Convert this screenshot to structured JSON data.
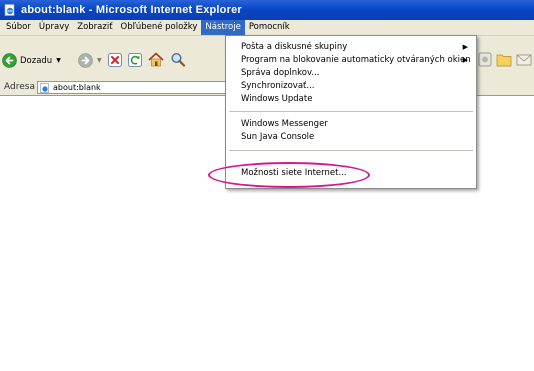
{
  "window": {
    "title": "about:blank - Microsoft Internet Explorer"
  },
  "menubar": {
    "items": [
      "Súbor",
      "Úpravy",
      "Zobraziť",
      "Obľúbené položky",
      "Nástroje",
      "Pomocník"
    ],
    "active_index": 4
  },
  "toolbar": {
    "back_label": "Dozadu"
  },
  "address": {
    "label": "Adresa",
    "value": "about:blank"
  },
  "tools_menu": {
    "items": [
      {
        "label": "Pošta a diskusné skupiny",
        "submenu": true
      },
      {
        "label": "Program na blokovanie automaticky otváraných okien",
        "submenu": true
      },
      {
        "label": "Správa doplnkov...",
        "submenu": false
      },
      {
        "label": "Synchronizovať...",
        "submenu": false
      },
      {
        "label": "Windows Update",
        "submenu": false
      },
      {
        "label": "Windows Messenger",
        "submenu": false
      },
      {
        "label": "Sun Java Console",
        "submenu": false
      },
      {
        "label": "Možnosti siete Internet...",
        "submenu": false
      }
    ]
  },
  "colors": {
    "title_bar": "#0847c6",
    "menu_highlight": "#316ac5",
    "annotation": "#d21a8f"
  }
}
